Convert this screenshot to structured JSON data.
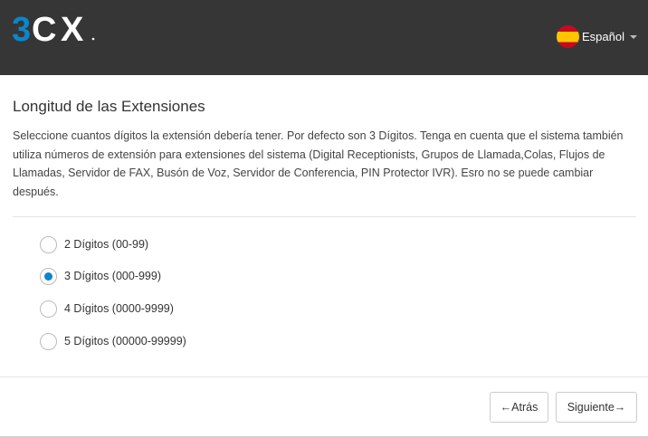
{
  "header": {
    "logo_text": "3CX",
    "language": "Español",
    "colors": {
      "background": "#363636",
      "logo_blue": "#0b86ca",
      "logo_white": "#ffffff"
    }
  },
  "page": {
    "title": "Longitud de las Extensiones",
    "description": "Seleccione cuantos dígitos la extensión debería tener. Por defecto son 3 Dígitos. Tenga en cuenta que el sistema también utiliza números de extensión para extensiones del sistema (Digital Receptionists, Grupos de Llamada,Colas, Flujos de Llamadas, Servidor de FAX, Busón de Voz, Servidor de Conferencia, PIN Protector IVR). Esro no se puede cambiar después."
  },
  "options": [
    {
      "label": "2 Dígitos (00-99)",
      "checked": false
    },
    {
      "label": "3 Dígitos (000-999)",
      "checked": true
    },
    {
      "label": "4 Dígitos (0000-9999)",
      "checked": false
    },
    {
      "label": "5 Dígitos (00000-99999)",
      "checked": false
    }
  ],
  "footer": {
    "back_label": "←Atrás",
    "next_label": "Siguiente→"
  },
  "icons": {
    "flag": "spain-flag-icon",
    "caret": "caret-down-icon",
    "radio_selected_color": "#0b86ca"
  }
}
